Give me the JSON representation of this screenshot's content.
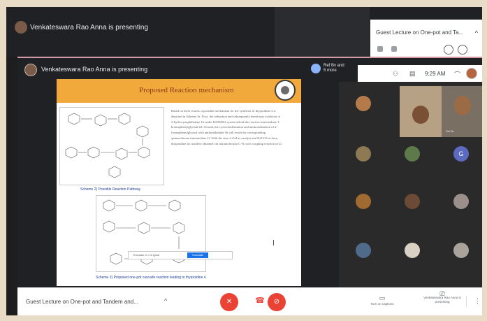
{
  "outer": {
    "title": "Venkateswara Rao Anna is presenting",
    "meeting_title": "Guest Lecture on One-pot and Ta...",
    "chevron": "^"
  },
  "inner": {
    "title": "Venkateswara Rao Anna is presenting",
    "people": "Ref Bv and 5 more",
    "time": "9:29 AM"
  },
  "slide": {
    "title": "Proposed Reaction mechanism",
    "scheme1_caption": "Scheme 2) Possible Reaction Pathway",
    "paragraph": "Based on these results, a possible mechanism for the synthesis of thyrpoidine 4 is depicted in Scheme 3a. First, the iodination and subsequently hemifuran oxidation of 2-hydroxynaphthalene 1b under I2/DMSO system afford the reactive intermediate 1-bromophenylglyoxal 2d. Second, the cyclocondensation and aminoiodination of 2-formophenylglyoxal with anthranilamide 3b will result the corresponding quinazolinone intermediate 2f. With the aim of CuI as catalyst and K2CO3 as base, thyrpoidine 4a could be obtained via intramolecular C-N cross coupling reaction of 2f.",
    "scheme2_caption": "Scheme 3) Proposed one-pot cascade reaction leading to thyrpoidine 4",
    "translate_button": "Translate",
    "translate_bar": "Translate to / Original"
  },
  "grid": {
    "tile_label": "Ref Bv",
    "guest_initial": "G"
  },
  "bottom": {
    "meeting_name": "Guest Lecture on One-pot and Tandem and...",
    "chevron": "^",
    "captions_label": "Turn on captions",
    "presenting_label": "Venkateswara Rao Anna is presenting",
    "more": "⋮"
  },
  "colors": {
    "accent_red": "#ea4335",
    "slide_header": "#f2a93b",
    "meet_dark": "#202124"
  }
}
